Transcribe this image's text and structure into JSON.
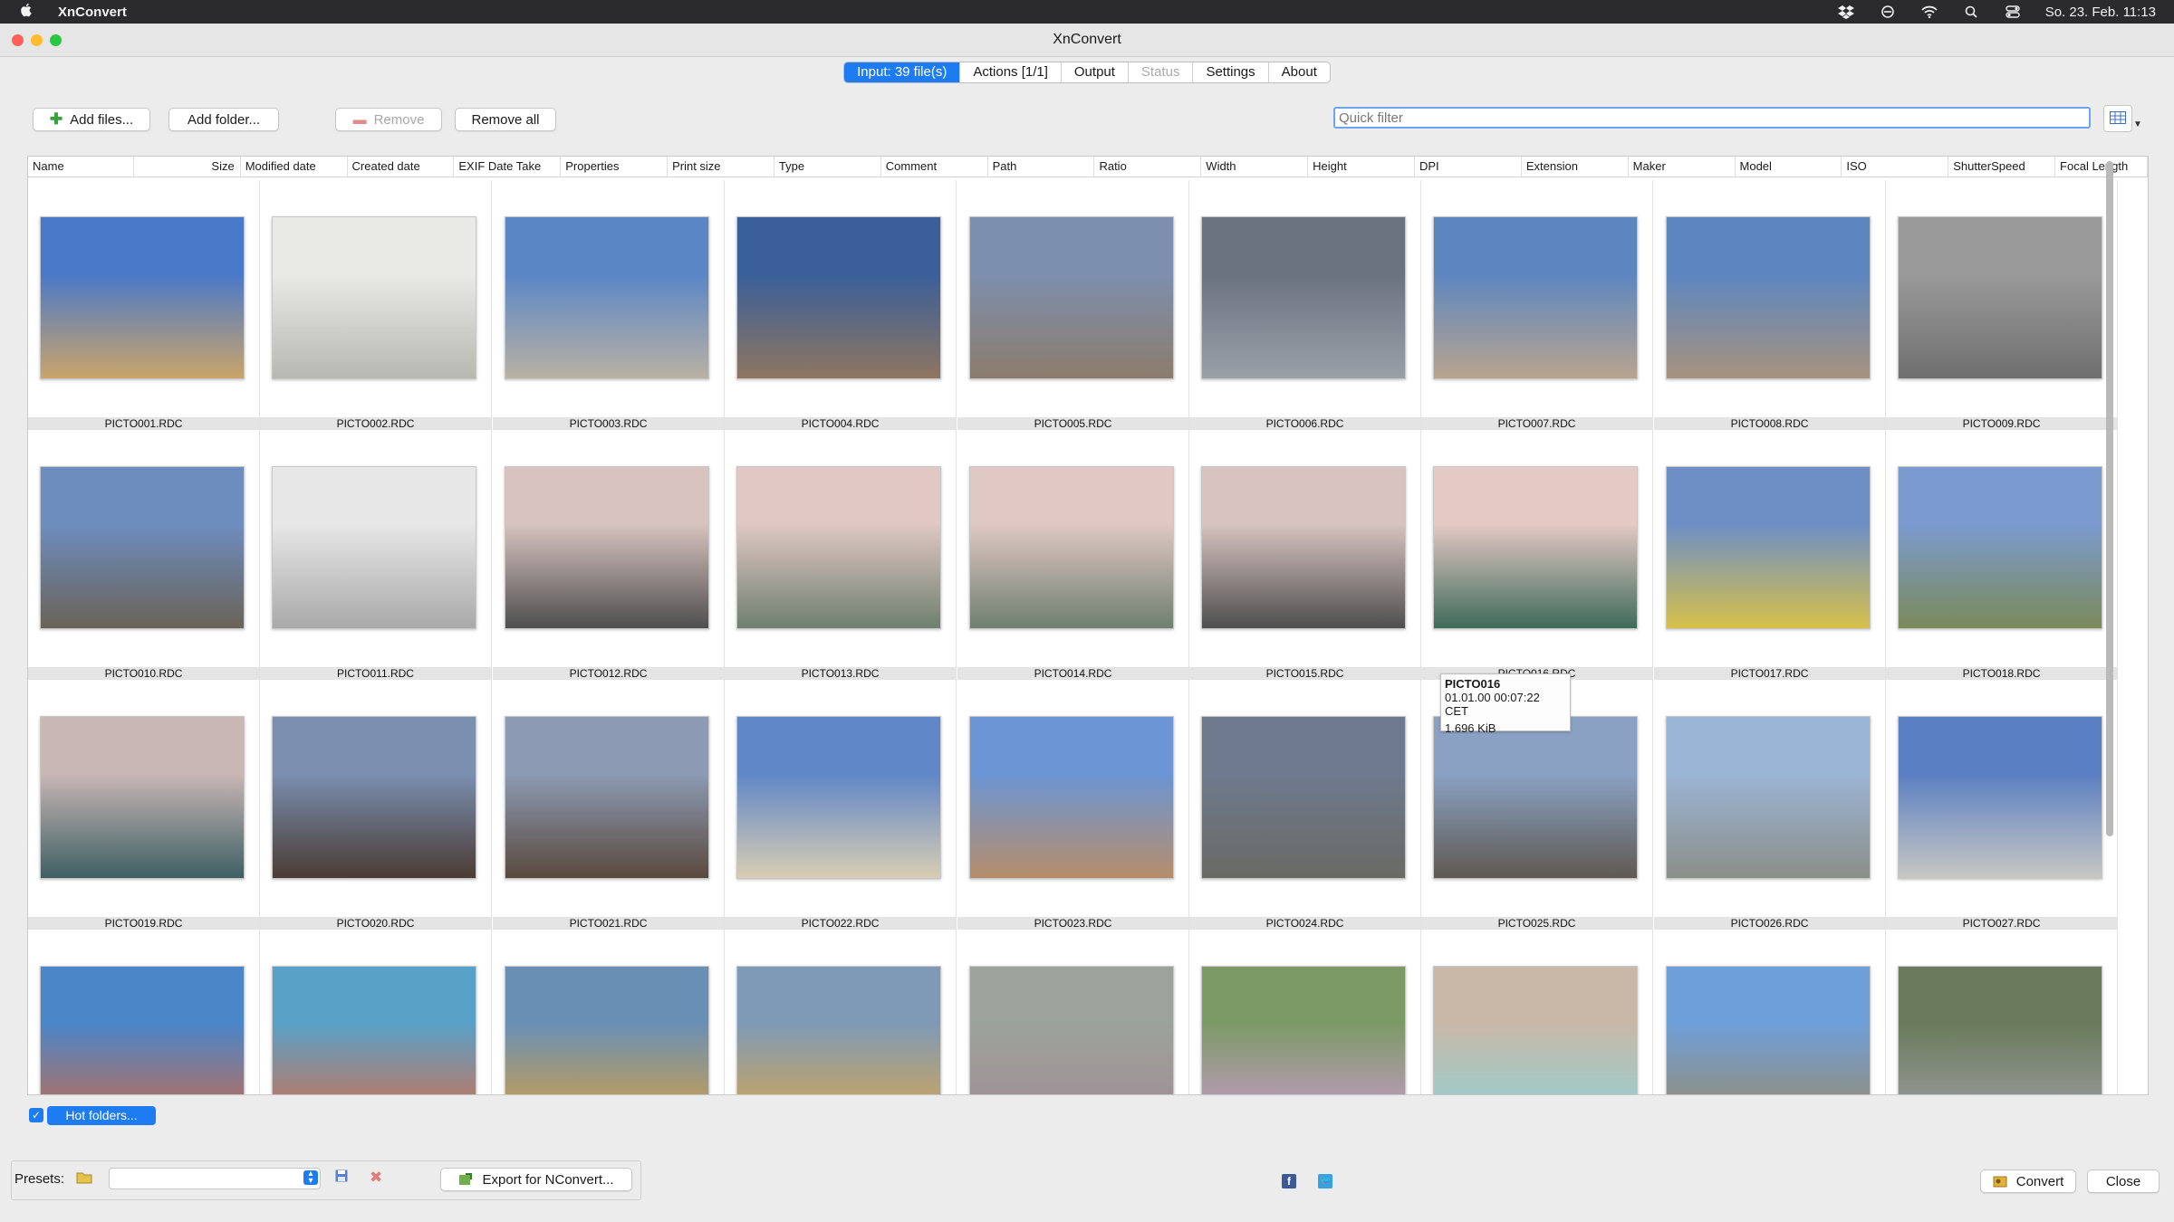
{
  "menubar": {
    "app": "XnConvert",
    "datetime": "So. 23. Feb.  11:13"
  },
  "window": {
    "title": "XnConvert"
  },
  "tabs": [
    {
      "label": "Input: 39 file(s)",
      "state": "active"
    },
    {
      "label": "Actions [1/1]",
      "state": "normal"
    },
    {
      "label": "Output",
      "state": "normal"
    },
    {
      "label": "Status",
      "state": "disabled"
    },
    {
      "label": "Settings",
      "state": "normal"
    },
    {
      "label": "About",
      "state": "normal"
    }
  ],
  "toolbar": {
    "add_files": "Add files...",
    "add_folder": "Add folder...",
    "remove": "Remove",
    "remove_all": "Remove all",
    "filter_placeholder": "Quick filter"
  },
  "columns": [
    "Name",
    "Size",
    "Modified date",
    "Created date",
    "EXIF Date Take",
    "Properties",
    "Print size",
    "Type",
    "Comment",
    "Path",
    "Ratio",
    "Width",
    "Height",
    "DPI",
    "Extension",
    "Maker",
    "Model",
    "ISO",
    "ShutterSpeed",
    "Focal Length"
  ],
  "files": [
    {
      "name": "PICTO001.RDC",
      "colors": [
        "#4a78c8",
        "#c9a46a"
      ]
    },
    {
      "name": "PICTO002.RDC",
      "colors": [
        "#e9e9e6",
        "#b8b8b2"
      ]
    },
    {
      "name": "PICTO003.RDC",
      "colors": [
        "#5a86c6",
        "#b9b1a3"
      ]
    },
    {
      "name": "PICTO004.RDC",
      "colors": [
        "#3a5f9a",
        "#8e7660"
      ]
    },
    {
      "name": "PICTO005.RDC",
      "colors": [
        "#7d8fae",
        "#8c7c6c"
      ]
    },
    {
      "name": "PICTO006.RDC",
      "colors": [
        "#6b7380",
        "#9aa0a8"
      ]
    },
    {
      "name": "PICTO007.RDC",
      "colors": [
        "#5d86c0",
        "#b8a48e"
      ]
    },
    {
      "name": "PICTO008.RDC",
      "colors": [
        "#5d86c0",
        "#a6927e"
      ]
    },
    {
      "name": "PICTO009.RDC",
      "colors": [
        "#9a9a9a",
        "#6f6f6f"
      ]
    },
    {
      "name": "PICTO010.RDC",
      "colors": [
        "#6e8dbf",
        "#6a6358"
      ]
    },
    {
      "name": "PICTO011.RDC",
      "colors": [
        "#e7e7e7",
        "#a9a9a9"
      ]
    },
    {
      "name": "PICTO012.RDC",
      "colors": [
        "#d8c3c0",
        "#4f4f4f"
      ]
    },
    {
      "name": "PICTO013.RDC",
      "colors": [
        "#e0c8c4",
        "#6f7f70"
      ]
    },
    {
      "name": "PICTO014.RDC",
      "colors": [
        "#e0c8c4",
        "#6f7f70"
      ]
    },
    {
      "name": "PICTO015.RDC",
      "colors": [
        "#d8c3c0",
        "#4f4f4f"
      ]
    },
    {
      "name": "PICTO016.RDC",
      "colors": [
        "#e5c9c5",
        "#3f6b5a"
      ]
    },
    {
      "name": "PICTO017.RDC",
      "colors": [
        "#6d8fc6",
        "#d7c04a"
      ]
    },
    {
      "name": "PICTO018.RDC",
      "colors": [
        "#7b9bd0",
        "#7a8a5a"
      ]
    },
    {
      "name": "PICTO019.RDC",
      "colors": [
        "#c9b7b6",
        "#3f5f63"
      ]
    },
    {
      "name": "PICTO020.RDC",
      "colors": [
        "#7a8fb0",
        "#4b3c34"
      ]
    },
    {
      "name": "PICTO021.RDC",
      "colors": [
        "#8c9bb3",
        "#5a4a40"
      ]
    },
    {
      "name": "PICTO022.RDC",
      "colors": [
        "#5f86c7",
        "#d8cdb2"
      ]
    },
    {
      "name": "PICTO023.RDC",
      "colors": [
        "#6b95d4",
        "#b68d6b"
      ]
    },
    {
      "name": "PICTO024.RDC",
      "colors": [
        "#6e7a8e",
        "#6a6a64"
      ]
    },
    {
      "name": "PICTO025.RDC",
      "colors": [
        "#8aa1c4",
        "#5f5a52"
      ]
    },
    {
      "name": "PICTO026.RDC",
      "colors": [
        "#9bb5d6",
        "#8a8f88"
      ]
    },
    {
      "name": "PICTO027.RDC",
      "colors": [
        "#5a7fc2",
        "#c7c7c3"
      ]
    },
    {
      "name": "",
      "colors": [
        "#4b86c9",
        "#c76a4c"
      ]
    },
    {
      "name": "",
      "colors": [
        "#5aa1c7",
        "#d46d4d"
      ]
    },
    {
      "name": "",
      "colors": [
        "#6a8fb5",
        "#d4a143"
      ]
    },
    {
      "name": "",
      "colors": [
        "#7f9ab6",
        "#d6a650"
      ]
    },
    {
      "name": "",
      "colors": [
        "#9ca39a",
        "#a08c96"
      ]
    },
    {
      "name": "",
      "colors": [
        "#7c9a66",
        "#c99bcc"
      ]
    },
    {
      "name": "",
      "colors": [
        "#c9b8a8",
        "#8fd1d5"
      ]
    },
    {
      "name": "",
      "colors": [
        "#6f9fd9",
        "#9a8a6a"
      ]
    },
    {
      "name": "",
      "colors": [
        "#6a7a5a",
        "#9fa0a6"
      ]
    }
  ],
  "tooltip": {
    "name": "PICTO016",
    "date": "01.01.00 00:07:22 CET",
    "size": "1.696 KiB"
  },
  "hot_folders": "Hot folders...",
  "bottom": {
    "presets_label": "Presets:",
    "export": "Export for NConvert...",
    "convert": "Convert",
    "close": "Close"
  }
}
